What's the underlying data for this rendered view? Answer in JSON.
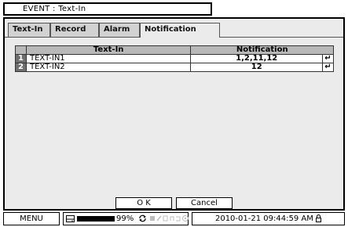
{
  "window": {
    "title": "EVENT : Text-In"
  },
  "tabs": [
    {
      "label": "Text-In"
    },
    {
      "label": "Record"
    },
    {
      "label": "Alarm"
    },
    {
      "label": "Notification"
    }
  ],
  "table": {
    "headers": [
      "Text-In",
      "Notification"
    ],
    "rows": [
      {
        "index": "1",
        "name": "TEXT-IN1",
        "notification": "1,2,11,12",
        "enter": "↵"
      },
      {
        "index": "2",
        "name": "TEXT-IN2",
        "notification": "12",
        "enter": "↵"
      }
    ]
  },
  "buttons": {
    "ok": "O K",
    "cancel": "Cancel"
  },
  "status_bar": {
    "menu": "MENU",
    "disk_percent": "99%",
    "disk_fill": 0.99,
    "datetime": "2010-01-21 09:44:59 AM"
  }
}
